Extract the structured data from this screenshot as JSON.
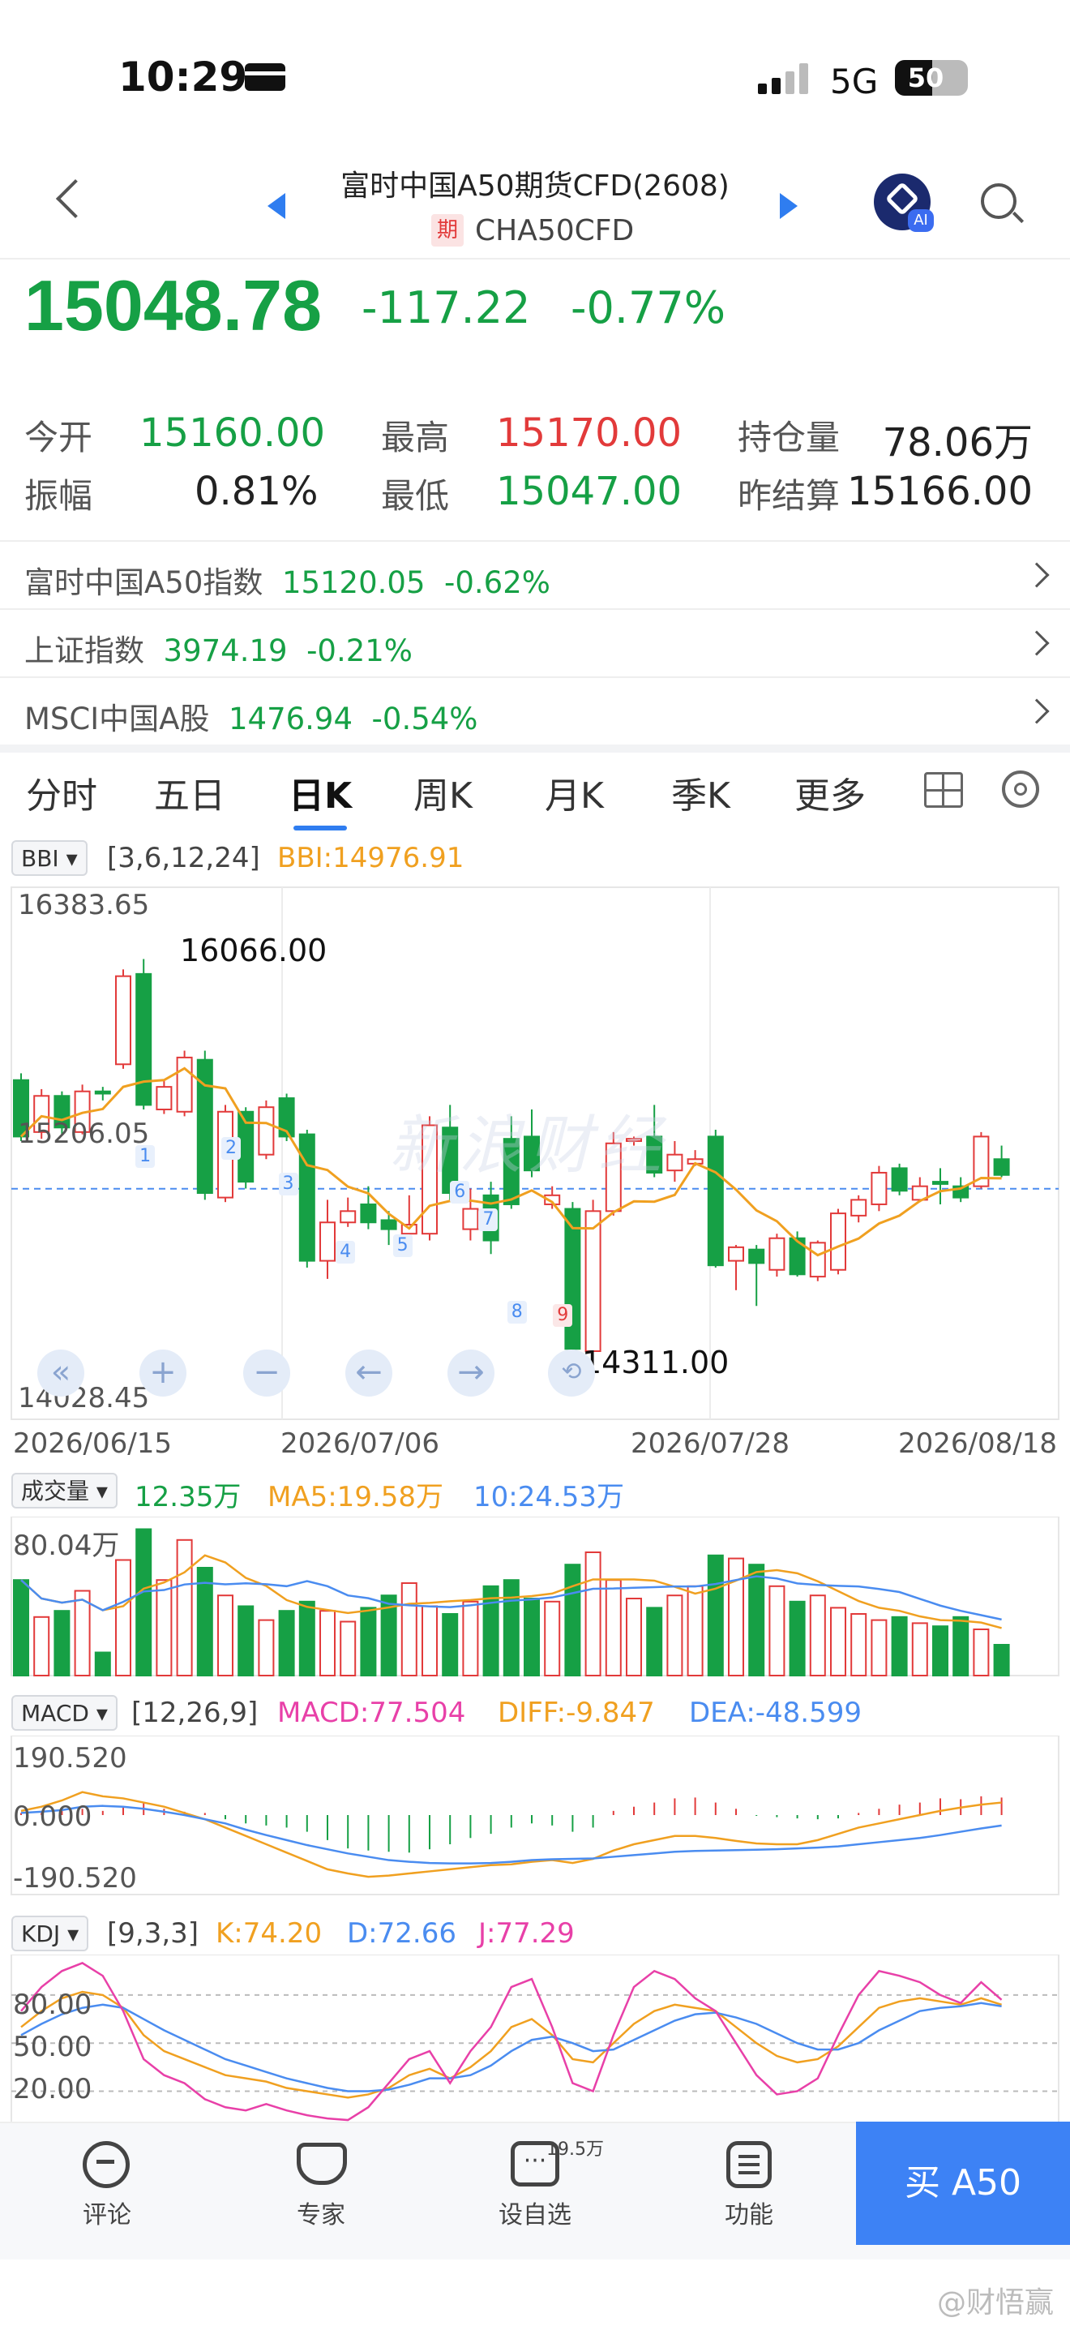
{
  "status_bar": {
    "time": "10:29",
    "network": "5G",
    "battery": "50"
  },
  "header": {
    "title": "富时中国A50期货CFD(2608)",
    "badge": "期",
    "code": "CHA50CFD",
    "ai_label": "AI"
  },
  "quote": {
    "price": "15048.78",
    "change": "-117.22",
    "change_pct": "-0.77%"
  },
  "stats": {
    "open_label": "今开",
    "open": "15160.00",
    "high_label": "最高",
    "high": "15170.00",
    "oi_label": "持仓量",
    "oi": "78.06万",
    "amp_label": "振幅",
    "amp": "0.81%",
    "low_label": "最低",
    "low": "15047.00",
    "prev_label": "昨结算",
    "prev": "15166.00"
  },
  "related": [
    {
      "name": "富时中国A50指数",
      "value": "15120.05",
      "pct": "-0.62%"
    },
    {
      "name": "上证指数",
      "value": "3974.19",
      "pct": "-0.21%"
    },
    {
      "name": "MSCI中国A股",
      "value": "1476.94",
      "pct": "-0.54%"
    }
  ],
  "tabs": [
    "分时",
    "五日",
    "日K",
    "周K",
    "月K",
    "季K",
    "更多"
  ],
  "active_tab": "日K",
  "main_indicator": {
    "name": "BBI",
    "params": "[3,6,12,24]",
    "value": "BBI:14976.91"
  },
  "price_axis": {
    "top": "16383.65",
    "mid": "15206.05",
    "bottom": "14028.45",
    "max_label": "16066.00",
    "min_label": "14311.00"
  },
  "date_axis": [
    "2026/06/15",
    "2026/07/06",
    "2026/07/28",
    "2026/08/18"
  ],
  "volume": {
    "name": "成交量",
    "value": "12.35万",
    "ma5": "MA5:19.58万",
    "ma10": "10:24.53万",
    "axis_top": "80.04万"
  },
  "macd": {
    "name": "MACD",
    "params": "[12,26,9]",
    "macd": "MACD:77.504",
    "diff": "DIFF:-9.847",
    "dea": "DEA:-48.599",
    "top": "190.520",
    "zero": "0.000",
    "bottom": "-190.520"
  },
  "kdj": {
    "name": "KDJ",
    "params": "[9,3,3]",
    "k": "K:74.20",
    "d": "D:72.66",
    "j": "J:77.29",
    "levels": [
      "80.00",
      "50.00",
      "20.00"
    ]
  },
  "markers": [
    "1",
    "2",
    "3",
    "4",
    "5",
    "6",
    "7",
    "8",
    "9"
  ],
  "watermark": "新浪财经",
  "bottom_nav": {
    "comment": "评论",
    "expert": "专家",
    "watch": "设自选",
    "watch_count": "19.5万",
    "function": "功能",
    "buy": "买 A50"
  },
  "weibo_watermark": "@财悟赢",
  "colors": {
    "up": "#e23a3a",
    "down": "#16a045",
    "bbi": "#f0a020",
    "accent": "#4a8cf0"
  },
  "chart_data": {
    "type": "candlestick",
    "dates_shown": [
      "2026/06/15",
      "2026/07/06",
      "2026/07/28",
      "2026/08/18"
    ],
    "price_range": [
      14028.45,
      16383.65
    ],
    "candles": [
      [
        15530,
        15280,
        15560,
        15260
      ],
      [
        15300,
        15460,
        15490,
        15270
      ],
      [
        15460,
        15320,
        15480,
        15290
      ],
      [
        15300,
        15480,
        15510,
        15290
      ],
      [
        15480,
        15470,
        15500,
        15440
      ],
      [
        15600,
        15990,
        16020,
        15580
      ],
      [
        16000,
        15420,
        16066,
        15400
      ],
      [
        15400,
        15500,
        15530,
        15380
      ],
      [
        15390,
        15630,
        15660,
        15370
      ],
      [
        15620,
        15030,
        15660,
        15000
      ],
      [
        15010,
        15390,
        15420,
        14990
      ],
      [
        15390,
        15080,
        15410,
        15050
      ],
      [
        15200,
        15410,
        15440,
        15180
      ],
      [
        15450,
        15280,
        15470,
        15260
      ],
      [
        15290,
        14730,
        15310,
        14700
      ],
      [
        14730,
        14900,
        15000,
        14650
      ],
      [
        14900,
        14950,
        15010,
        14880
      ],
      [
        14980,
        14900,
        15060,
        14870
      ],
      [
        14910,
        14870,
        14950,
        14800
      ],
      [
        14850,
        14890,
        15020,
        14830
      ],
      [
        14850,
        15330,
        15370,
        14820
      ],
      [
        15320,
        15030,
        15420,
        14990
      ],
      [
        14870,
        14960,
        15050,
        14820
      ],
      [
        15020,
        14820,
        15080,
        14760
      ],
      [
        15270,
        14980,
        15370,
        14960
      ],
      [
        15280,
        15130,
        15400,
        15100
      ],
      [
        14980,
        15020,
        15060,
        14960
      ],
      [
        14960,
        14340,
        14990,
        14311
      ],
      [
        14330,
        14950,
        15000,
        14330
      ],
      [
        14950,
        15250,
        15300,
        14930
      ],
      [
        15260,
        15270,
        15280,
        15240
      ],
      [
        15280,
        15120,
        15420,
        15100
      ],
      [
        15130,
        15200,
        15260,
        15080
      ],
      [
        15160,
        15180,
        15220,
        15150
      ],
      [
        15280,
        14710,
        15310,
        14700
      ],
      [
        14730,
        14790,
        14800,
        14600
      ],
      [
        14780,
        14720,
        14800,
        14530
      ],
      [
        14690,
        14830,
        14850,
        14660
      ],
      [
        14830,
        14670,
        14860,
        14660
      ],
      [
        14660,
        14810,
        14820,
        14640
      ],
      [
        14690,
        14940,
        14960,
        14670
      ],
      [
        14930,
        15000,
        15020,
        14900
      ],
      [
        14980,
        15120,
        15150,
        14950
      ],
      [
        15140,
        15040,
        15160,
        15020
      ],
      [
        15000,
        15060,
        15100,
        14990
      ],
      [
        15080,
        15070,
        15140,
        14980
      ],
      [
        15060,
        15010,
        15100,
        14990
      ],
      [
        15060,
        15280,
        15300,
        15050
      ],
      [
        15180,
        15110,
        15240,
        15100
      ]
    ]
  }
}
